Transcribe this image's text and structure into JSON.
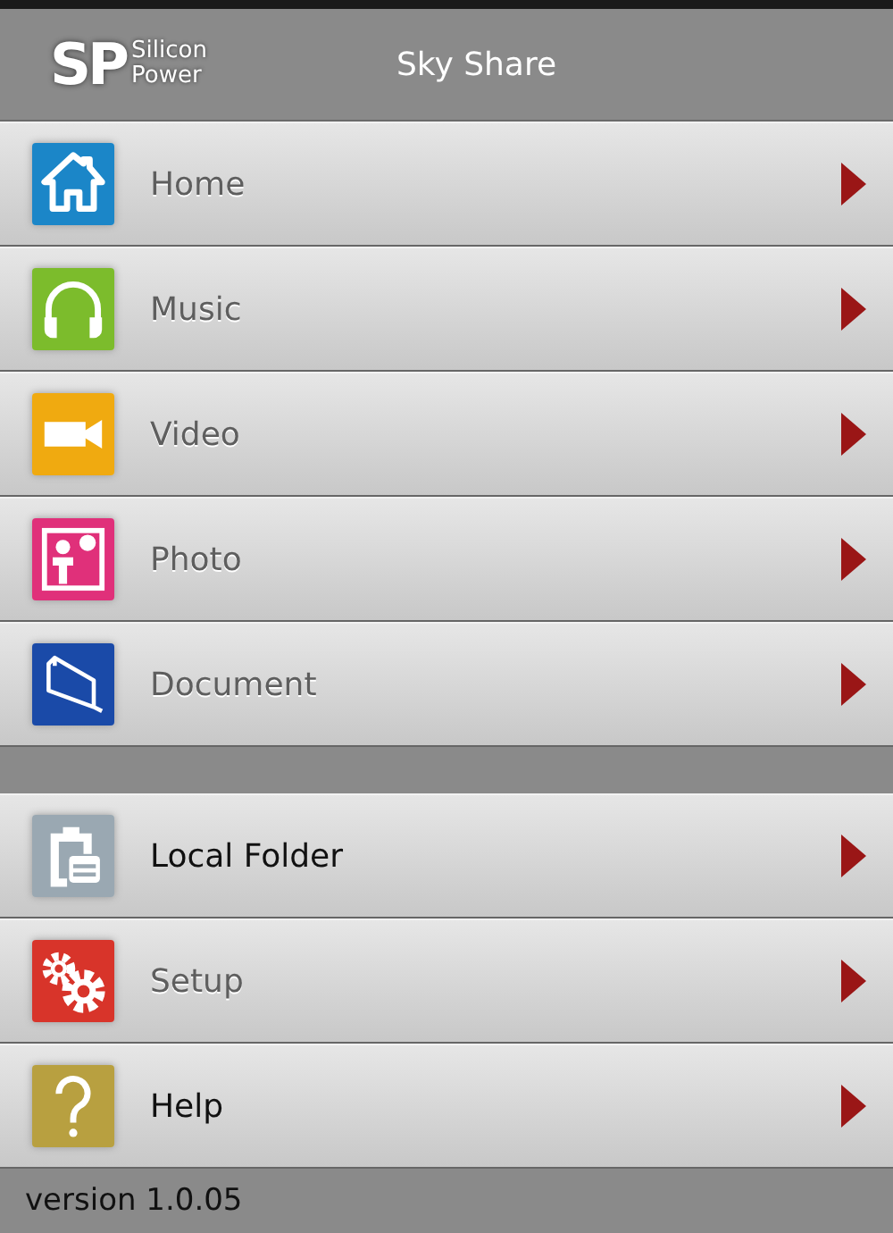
{
  "header": {
    "logo": {
      "mark": "SP",
      "line_1": "Silicon",
      "line_2": "Power"
    },
    "title": "Sky Share"
  },
  "groups": [
    {
      "items": [
        {
          "label": "Home",
          "kind": "home",
          "color": "#1b86c8",
          "disabled": true
        },
        {
          "label": "Music",
          "kind": "headphones",
          "color": "#7cbc2c",
          "disabled": true
        },
        {
          "label": "Video",
          "kind": "camera",
          "color": "#f0aa10",
          "disabled": true
        },
        {
          "label": "Photo",
          "kind": "photo",
          "color": "#e0307a",
          "disabled": true
        },
        {
          "label": "Document",
          "kind": "folder",
          "color": "#1a4aa8",
          "disabled": true
        }
      ]
    },
    {
      "items": [
        {
          "label": "Local Folder",
          "kind": "clipboard",
          "color": "#9aa8b2",
          "disabled": false
        },
        {
          "label": "Setup",
          "kind": "gears",
          "color": "#d8342a",
          "disabled": true
        },
        {
          "label": "Help",
          "kind": "question",
          "color": "#b8a040",
          "disabled": false
        }
      ]
    }
  ],
  "footer": {
    "version": "version 1.0.05"
  }
}
